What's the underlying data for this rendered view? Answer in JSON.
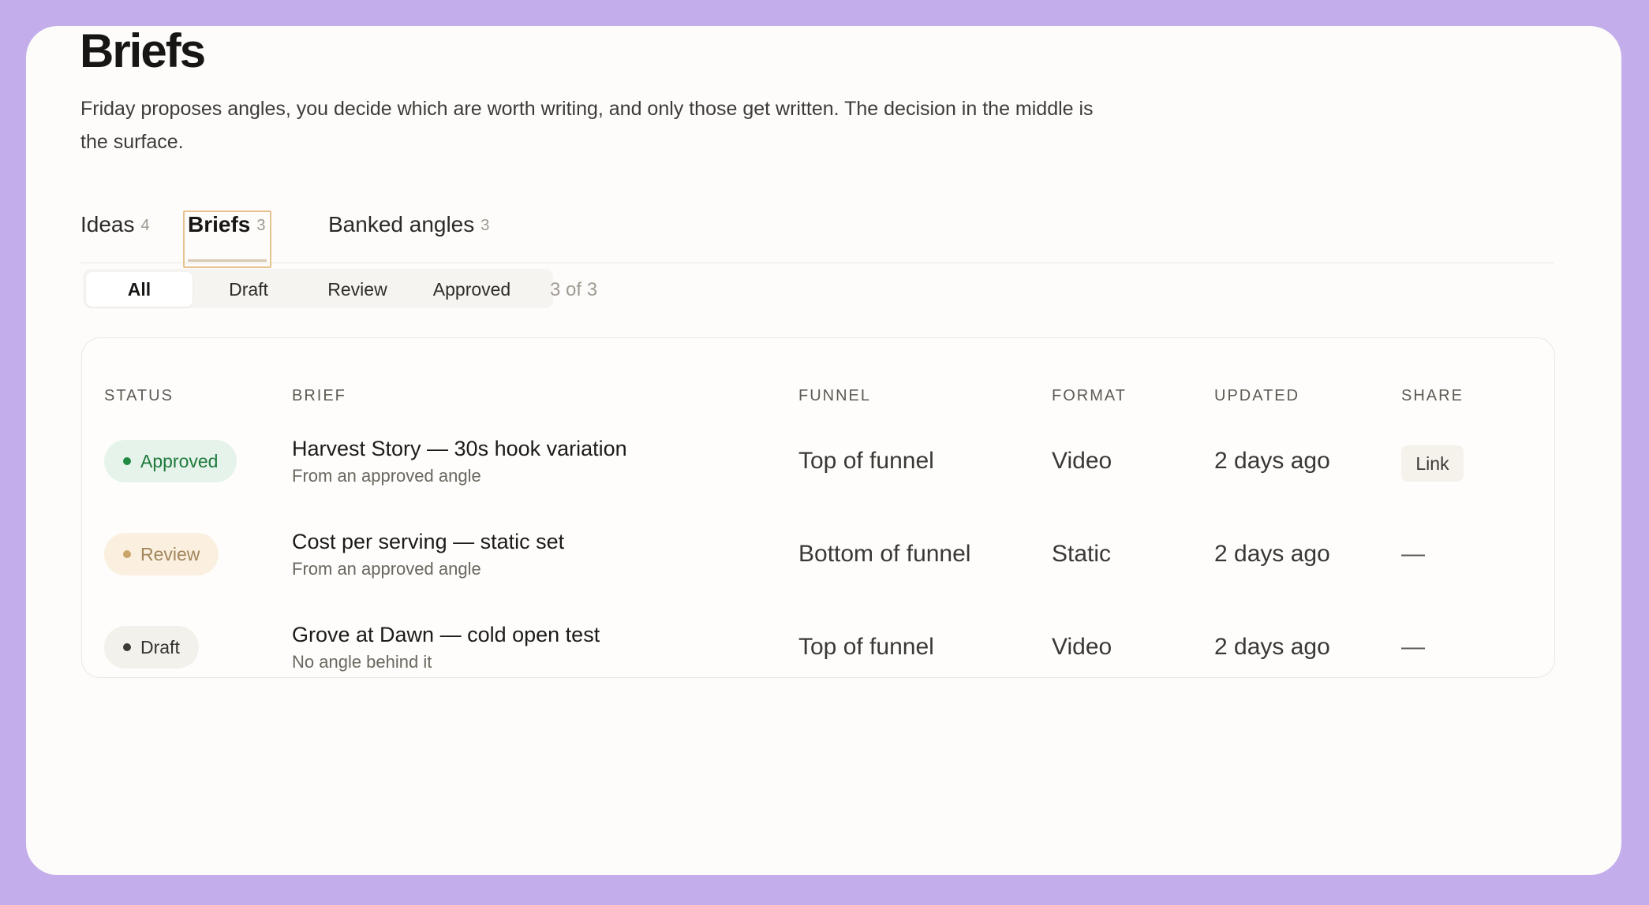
{
  "page": {
    "title": "Briefs",
    "description": "Friday proposes angles, you decide which are worth writing, and only those get written. The decision in the middle is the surface."
  },
  "tabs": [
    {
      "label": "Ideas",
      "count": "4"
    },
    {
      "label": "Briefs",
      "count": "3",
      "active": true
    },
    {
      "label": "Banked angles",
      "count": "3"
    }
  ],
  "filters": {
    "options": [
      "All",
      "Draft",
      "Review",
      "Approved"
    ],
    "selected": "All",
    "count_text": "3 of 3"
  },
  "table": {
    "columns": [
      "STATUS",
      "BRIEF",
      "FUNNEL",
      "FORMAT",
      "UPDATED",
      "SHARE"
    ],
    "rows": [
      {
        "status": "Approved",
        "title": "Harvest Story — 30s hook variation",
        "subtitle": "From an approved angle",
        "funnel": "Top of funnel",
        "format": "Video",
        "updated": "2 days ago",
        "share": "Link"
      },
      {
        "status": "Review",
        "title": "Cost per serving — static set",
        "subtitle": "From an approved angle",
        "funnel": "Bottom of funnel",
        "format": "Static",
        "updated": "2 days ago",
        "share": "—"
      },
      {
        "status": "Draft",
        "title": "Grove at Dawn — cold open test",
        "subtitle": "No angle behind it",
        "funnel": "Top of funnel",
        "format": "Video",
        "updated": "2 days ago",
        "share": "—"
      }
    ]
  },
  "colors": {
    "background": "#c3aeeb",
    "card": "#fdfcfa",
    "approved_bg": "#e6f3ea",
    "approved_text": "#1f7a3c",
    "review_bg": "#fbf0df",
    "review_text": "#a2855a",
    "review_dot": "#c9a56a",
    "draft_bg": "#f3f1ec",
    "draft_text": "#34322e",
    "active_tab_outline": "#e7c28d"
  }
}
